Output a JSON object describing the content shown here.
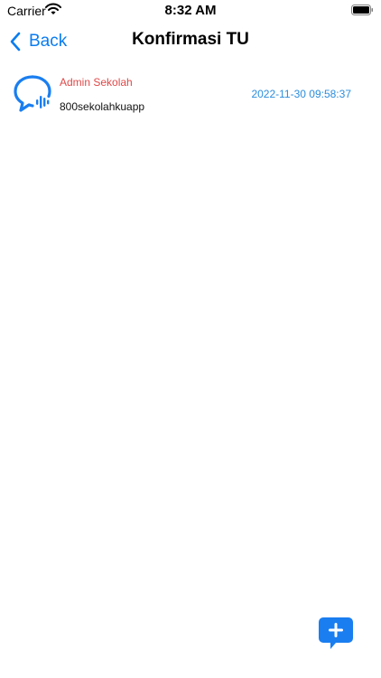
{
  "status_bar": {
    "carrier": "Carrier",
    "time": "8:32 AM"
  },
  "nav": {
    "back_label": "Back",
    "title": "Konfirmasi TU"
  },
  "messages": [
    {
      "sender": "Admin Sekolah",
      "text": "800sekolahkuapp",
      "timestamp": "2022-11-30 09:58:37"
    }
  ],
  "colors": {
    "accent": "#0a7cf0",
    "sender": "#e04848",
    "timestamp": "#2a8ddd",
    "fab": "#1a7ef0"
  },
  "icons": {
    "wifi": "wifi-icon",
    "battery": "battery-icon",
    "back": "chevron-left-icon",
    "item": "voice-chat-bubble-icon",
    "fab": "add-message-icon"
  }
}
